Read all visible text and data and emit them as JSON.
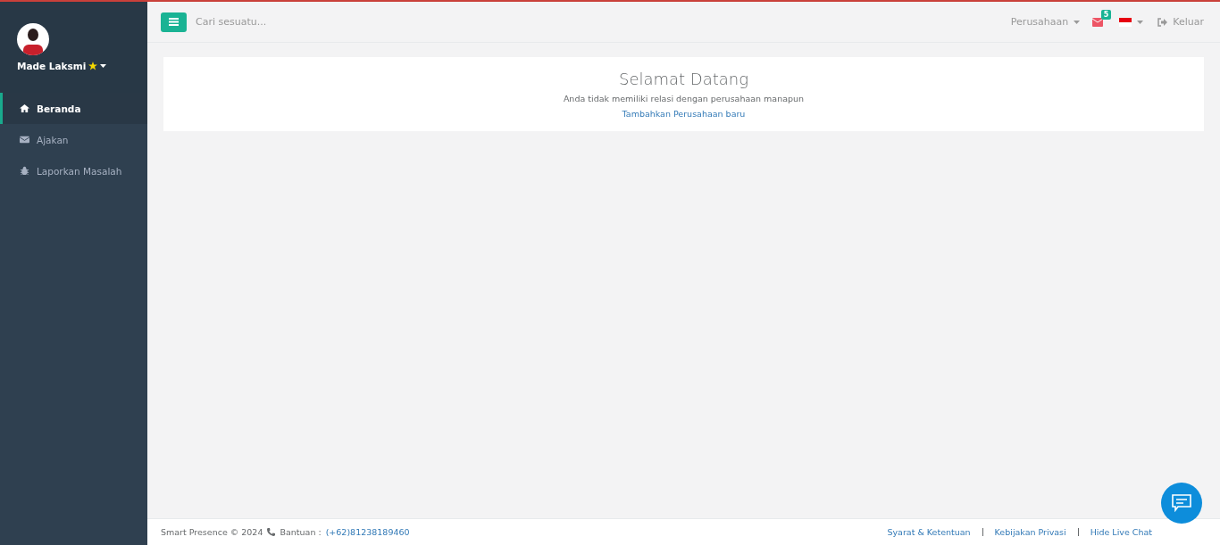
{
  "profile": {
    "name": "Made Laksmi"
  },
  "sidebar": {
    "items": [
      {
        "label": "Beranda",
        "selected": true
      },
      {
        "label": "Ajakan",
        "selected": false
      },
      {
        "label": "Laporkan Masalah",
        "selected": false
      }
    ]
  },
  "topbar": {
    "search": {
      "placeholder": "Cari sesuatu..."
    },
    "company_menu": "Perusahaan",
    "messages_badge": "5",
    "logout": "Keluar"
  },
  "welcome": {
    "title": "Selamat Datang",
    "message": "Anda tidak memiliki relasi dengan perusahaan manapun",
    "link": "Tambahkan Perusahaan baru"
  },
  "footer": {
    "copyright": "Smart Presence © 2024",
    "help_label": "Bantuan :",
    "help_phone": "(+62)81238189460",
    "links": [
      "Syarat & Ketentuan",
      "Kebijakan Privasi",
      "Hide Live Chat"
    ]
  }
}
